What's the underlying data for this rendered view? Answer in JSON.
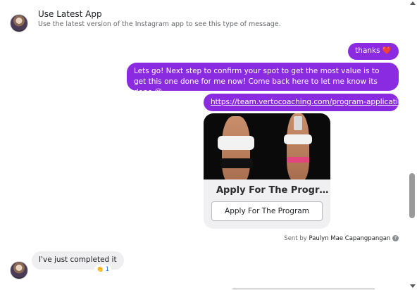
{
  "system_notice": {
    "title": "Use Latest App",
    "subtitle": "Use the latest version of the Instagram app to see this type of message."
  },
  "messages": {
    "thanks": {
      "text": "thanks ❤️"
    },
    "lets_go": {
      "text": "Lets go! Next step to confirm your spot to get the most value is to get this one done for me now! Come back here to let me know its done 😉"
    },
    "link": {
      "text": "https://team.vertocoaching.com/program-application-cj"
    },
    "card": {
      "title": "Apply For The Progr…",
      "button_label": "Apply For The Program"
    },
    "sent_by": {
      "prefix": "Sent by",
      "name": "Paulyn Mae Capangpangan",
      "help_icon": "?"
    },
    "incoming": {
      "text": "I've just completed it",
      "reaction_count": "1",
      "reaction_icon": "👏"
    }
  },
  "colors": {
    "outgoing_bubble": "#8a2be2",
    "incoming_bubble": "#efeff1"
  }
}
